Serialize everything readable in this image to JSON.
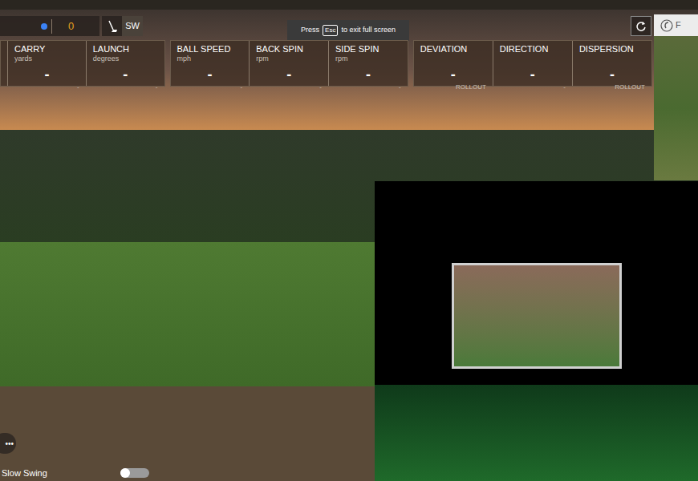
{
  "score": {
    "value": "0"
  },
  "club": {
    "label": "SW"
  },
  "fullscreen_hint": {
    "before": "Press",
    "key": "Esc",
    "after": "to exit full screen"
  },
  "stat_panels": [
    {
      "cells": [
        {
          "label": "CARRY",
          "unit": "yards",
          "value": "-",
          "sub": "-"
        },
        {
          "label": "LAUNCH",
          "unit": "degrees",
          "value": "-",
          "sub": "-"
        }
      ]
    },
    {
      "cells": [
        {
          "label": "BALL SPEED",
          "unit": "mph",
          "value": "-",
          "sub": "-"
        },
        {
          "label": "BACK SPIN",
          "unit": "rpm",
          "value": "-",
          "sub": "-"
        },
        {
          "label": "SIDE SPIN",
          "unit": "rpm",
          "value": "-",
          "sub": "-"
        }
      ]
    },
    {
      "cells": [
        {
          "label": "DEVIATION",
          "unit": "",
          "value": "-",
          "sub": "ROLLOUT"
        },
        {
          "label": "DIRECTION",
          "unit": "",
          "value": "-",
          "sub": "-"
        },
        {
          "label": "DISPERSION",
          "unit": "",
          "value": "-",
          "sub": "ROLLOUT"
        }
      ]
    }
  ],
  "logo": {
    "text": "F"
  },
  "menu_button": {
    "label": "•••"
  },
  "slow_swing": {
    "label": "Slow Swing",
    "on": false
  }
}
